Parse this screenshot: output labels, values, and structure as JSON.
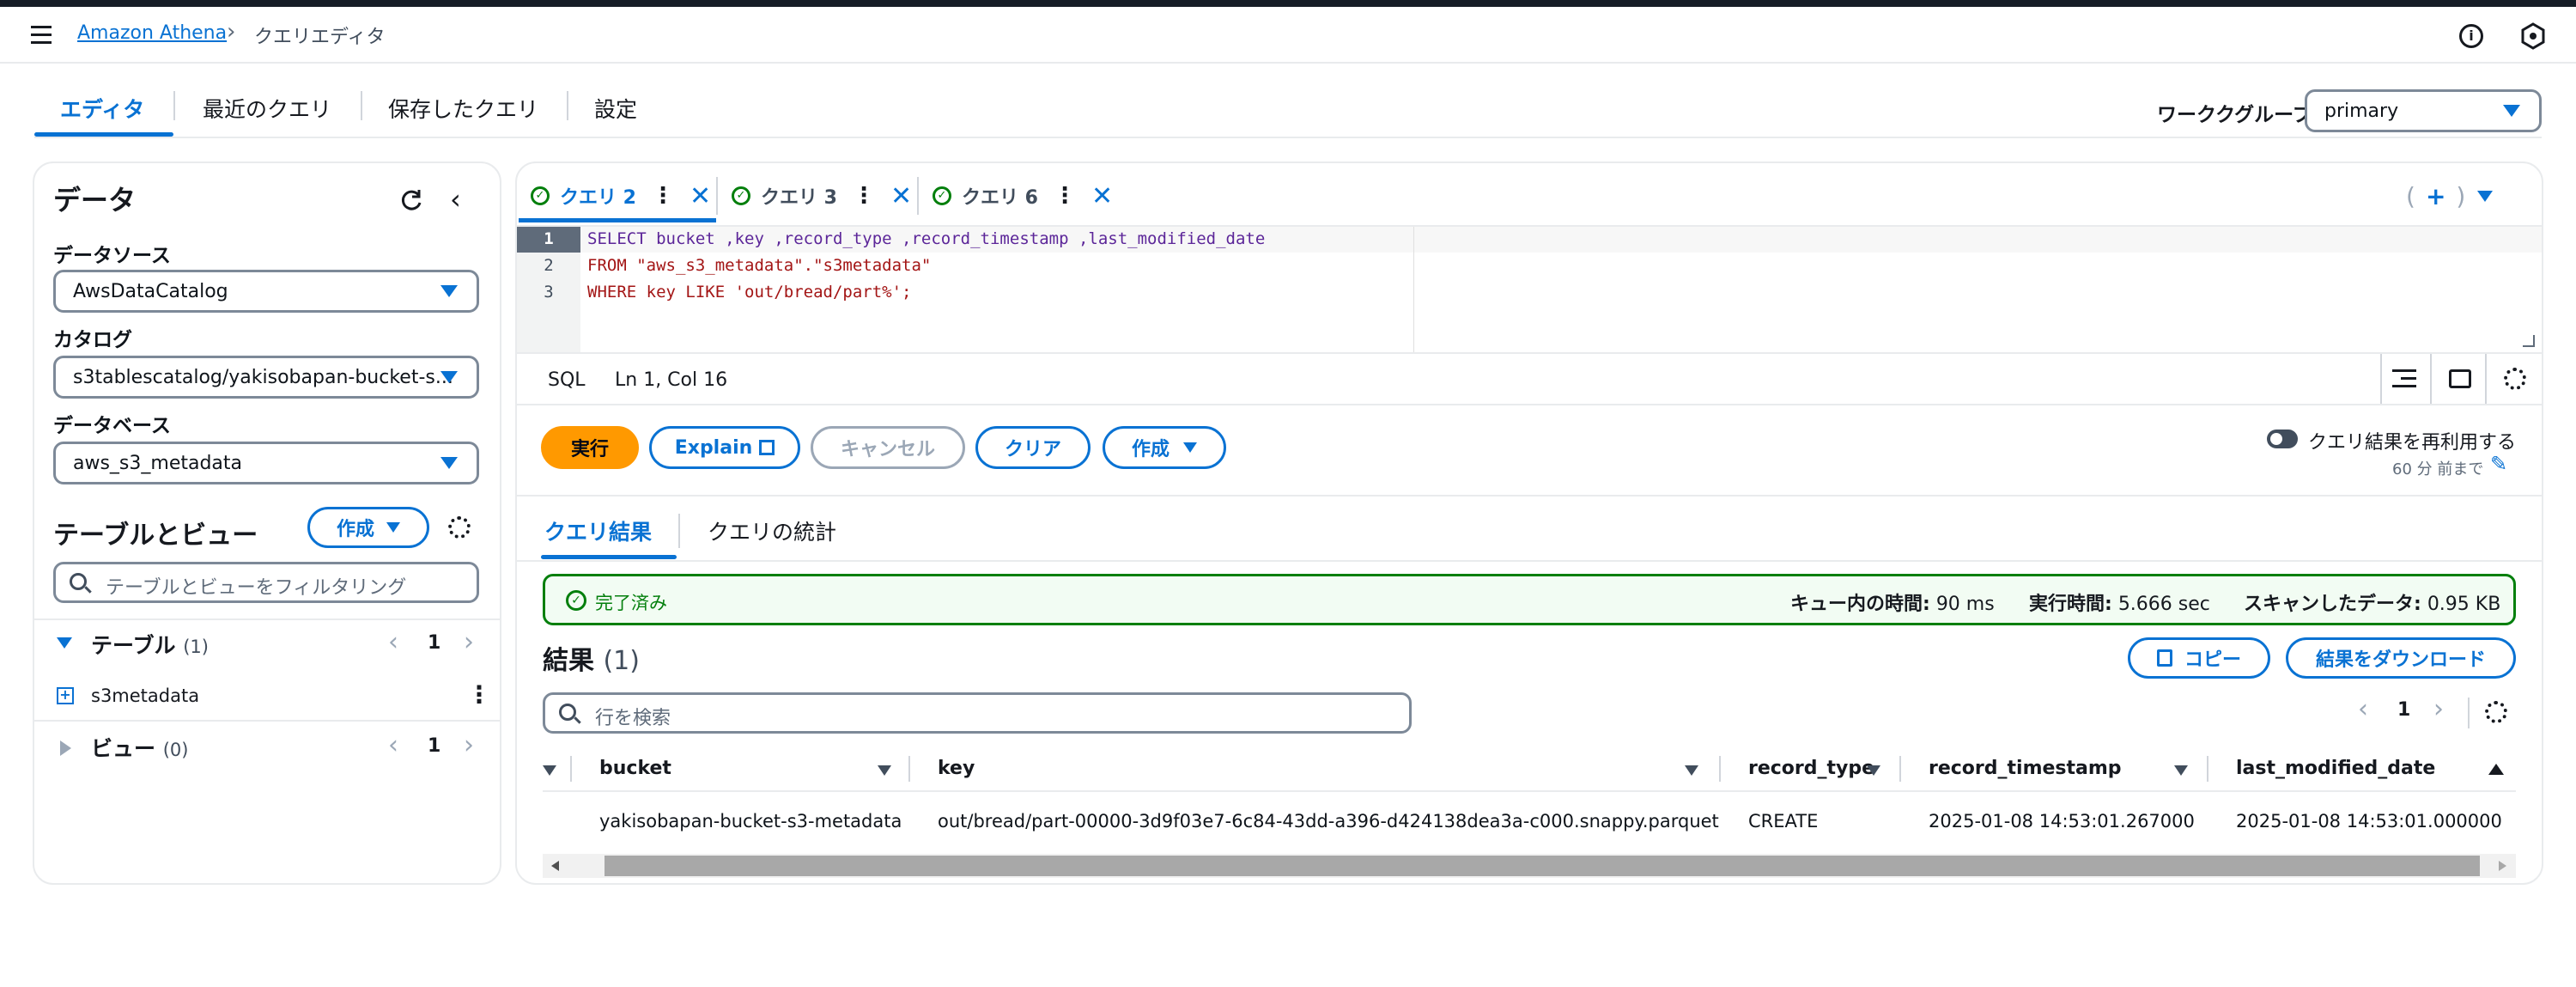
{
  "breadcrumb": {
    "service": "Amazon Athena",
    "current": "クエリエディタ"
  },
  "tabs": [
    "エディタ",
    "最近のクエリ",
    "保存したクエリ",
    "設定"
  ],
  "workgroup": {
    "label": "ワーククグループ",
    "value": "primary"
  },
  "data_panel": {
    "title": "データ",
    "datasource_label": "データソース",
    "datasource_value": "AwsDataCatalog",
    "catalog_label": "カタログ",
    "catalog_value": "s3tablescatalog/yakisobapan-bucket-s...",
    "database_label": "データベース",
    "database_value": "aws_s3_metadata",
    "tables_title": "テーブルとビュー",
    "create_label": "作成",
    "filter_placeholder": "テーブルとビューをフィルタリング",
    "tables_section": "テーブル",
    "tables_count": "(1)",
    "tables_page": "1",
    "table_item": "s3metadata",
    "views_section": "ビュー",
    "views_count": "(0)",
    "views_page": "1"
  },
  "query_tabs": [
    {
      "label": "クエリ 2"
    },
    {
      "label": "クエリ 3"
    },
    {
      "label": "クエリ 6"
    }
  ],
  "editor": {
    "lines": [
      {
        "n": "1",
        "code": "SELECT bucket ,key ,record_type ,record_timestamp ,last_modified_date"
      },
      {
        "n": "2",
        "code": "FROM \"aws_s3_metadata\".\"s3metadata\""
      },
      {
        "n": "3",
        "code": "WHERE key LIKE 'out/bread/part%';"
      }
    ],
    "lang": "SQL",
    "position": "Ln 1, Col 16"
  },
  "actions": {
    "run": "実行",
    "explain": "Explain",
    "cancel": "キャンセル",
    "clear": "クリア",
    "create": "作成",
    "reuse_label": "クエリ結果を再利用する",
    "reuse_sub": "60 分 前まで"
  },
  "result_tabs": [
    "クエリ結果",
    "クエリの統計"
  ],
  "status": {
    "state": "完了済み",
    "queue_label": "キュー内の時間:",
    "queue_value": "90 ms",
    "exec_label": "実行時間:",
    "exec_value": "5.666 sec",
    "scan_label": "スキャンしたデータ:",
    "scan_value": "0.95 KB"
  },
  "results": {
    "title": "結果",
    "count": "(1)",
    "copy": "コピー",
    "download": "結果をダウンロード",
    "search_placeholder": "行を検索",
    "page": "1",
    "columns": [
      "bucket",
      "key",
      "record_type",
      "record_timestamp",
      "last_modified_date"
    ],
    "row": [
      "yakisobapan-bucket-s3-metadata",
      "out/bread/part-00000-3d9f03e7-6c84-43dd-a396-d424138dea3a-c000.snappy.parquet",
      "CREATE",
      "2025-01-08 14:53:01.267000",
      "2025-01-08 14:53:01.000000"
    ]
  },
  "colors": {
    "accent": "#0972d3",
    "run": "#ff9900",
    "success": "#037f0c"
  }
}
